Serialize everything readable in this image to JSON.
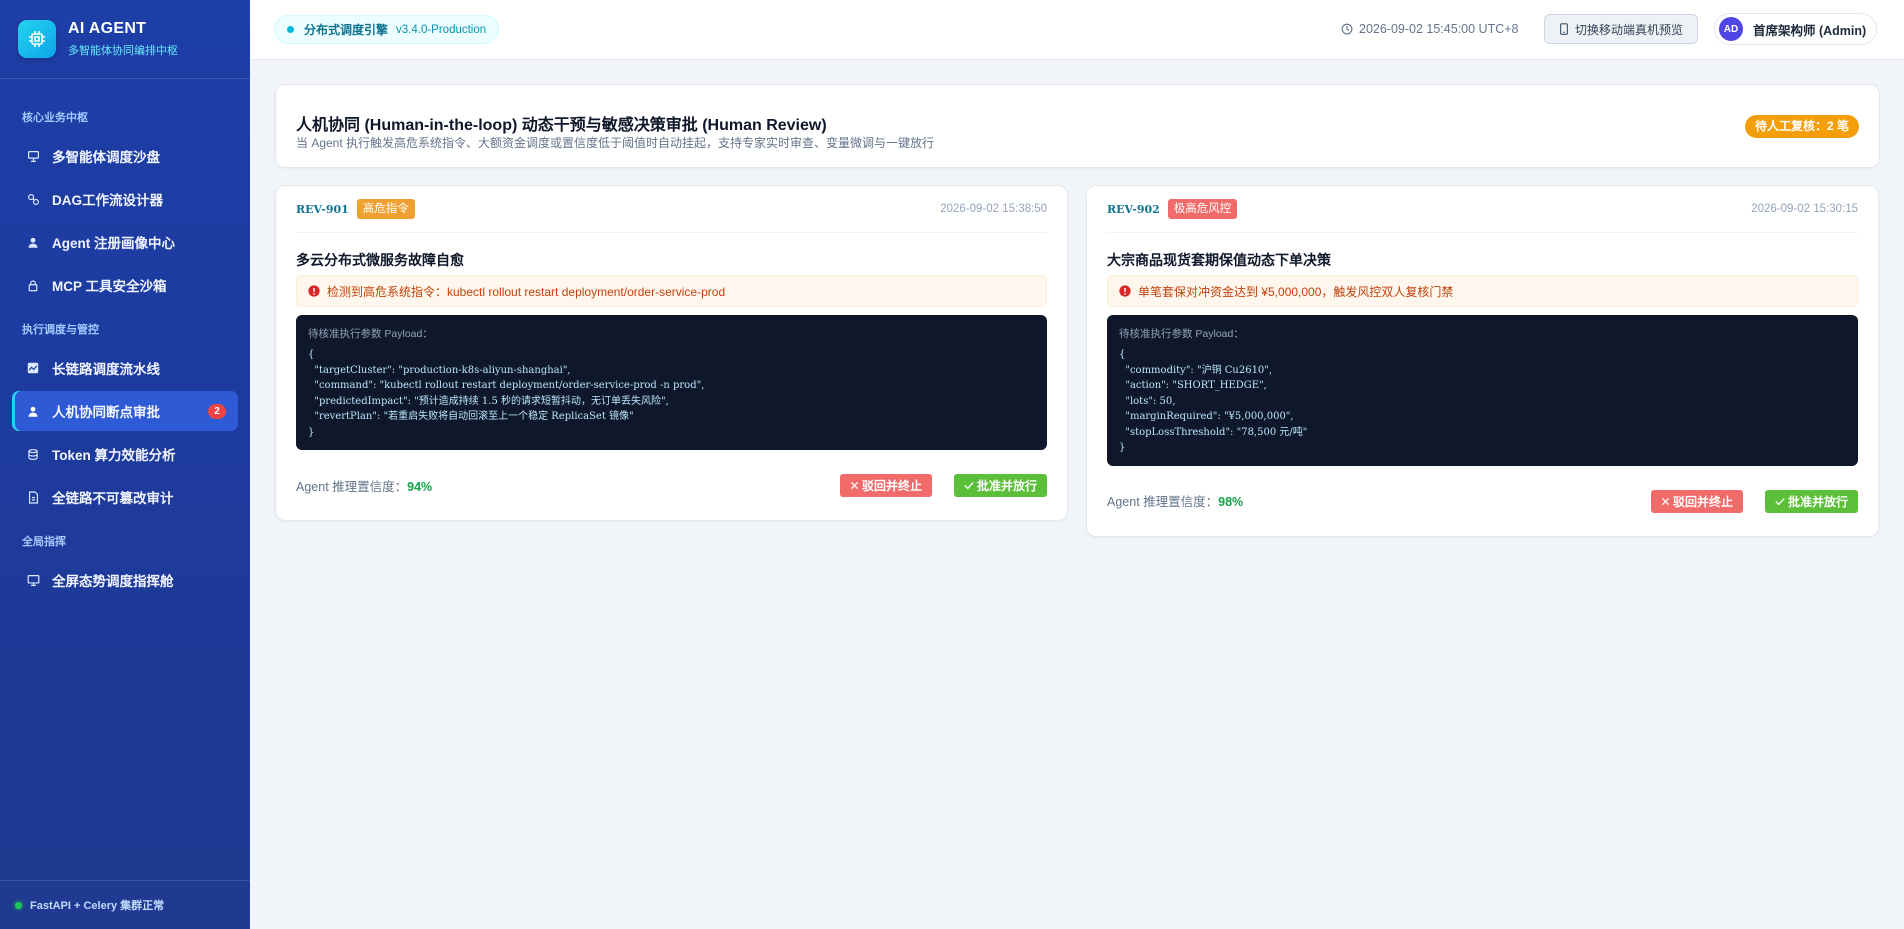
{
  "sidebar": {
    "brand": {
      "title": "AI AGENT",
      "subtitle": "多智能体协同编排中枢"
    },
    "sections": [
      {
        "label": "核心业务中枢",
        "items": [
          {
            "label": "多智能体调度沙盘",
            "icon": "presentation-icon"
          },
          {
            "label": "DAG工作流设计器",
            "icon": "workflow-icon"
          },
          {
            "label": "Agent 注册画像中心",
            "icon": "user-icon"
          },
          {
            "label": "MCP 工具安全沙箱",
            "icon": "lock-icon"
          }
        ]
      },
      {
        "label": "执行调度与管控",
        "items": [
          {
            "label": "长链路调度流水线",
            "icon": "chart-line-icon"
          },
          {
            "label": "人机协同断点审批",
            "icon": "user-check-icon",
            "badge": "2",
            "active": true
          },
          {
            "label": "Token 算力效能分析",
            "icon": "database-icon"
          },
          {
            "label": "全链路不可篡改审计",
            "icon": "file-icon"
          }
        ]
      },
      {
        "label": "全局指挥",
        "items": [
          {
            "label": "全屏态势调度指挥舱",
            "icon": "monitor-icon"
          }
        ]
      }
    ],
    "footer": {
      "status": "FastAPI + Celery 集群正常"
    }
  },
  "topbar": {
    "engine_label": "分布式调度引擎",
    "engine_version": "v3.4.0-Production",
    "clock": "2026-09-02 15:45:00 UTC+8",
    "mobile_preview": "切换移动端真机预览",
    "user": {
      "initials": "AD",
      "name": "首席架构师 (Admin)"
    }
  },
  "header": {
    "title": "人机协同 (Human-in-the-loop) 动态干预与敏感决策审批 (Human Review)",
    "description": "当 Agent 执行触发高危系统指令、大额资金调度或置信度低于阈值时自动挂起，支持专家实时审查、变量微调与一键放行",
    "pending": "待人工复核：2 笔"
  },
  "reviews": [
    {
      "id": "REV-901",
      "level": "高危指令",
      "time": "2026-09-02 15:38:50",
      "title": "多云分布式微服务故障自愈",
      "alert": "检测到高危系统指令：kubectl rollout restart deployment/order-service-prod",
      "payload_label": "待核准执行参数 Payload：",
      "code": [
        "{",
        "  \"targetCluster\": \"production-k8s-aliyun-shanghai\",",
        "  \"command\": \"kubectl rollout restart deployment/order-service-prod -n prod\",",
        "  \"predictedImpact\": \"预计造成持续 1.5 秒的请求短暂抖动，无订单丢失风险\",",
        "  \"revertPlan\": \"若重启失败将自动回滚至上一个稳定 ReplicaSet 镜像\"",
        "}"
      ],
      "confidence_label": "Agent 推理置信度：",
      "confidence": "94%",
      "reject": "驳回并终止",
      "approve": "批准并放行"
    },
    {
      "id": "REV-902",
      "level": "极高危风控",
      "time": "2026-09-02 15:30:15",
      "title": "大宗商品现货套期保值动态下单决策",
      "alert": "单笔套保对冲资金达到 ¥5,000,000，触发风控双人复核门禁",
      "payload_label": "待核准执行参数 Payload：",
      "code": [
        "{",
        "  \"commodity\": \"沪铜 Cu2610\",",
        "  \"action\": \"SHORT_HEDGE\",",
        "  \"lots\": 50,",
        "  \"marginRequired\": \"¥5,000,000\",",
        "  \"stopLossThreshold\": \"78,500 元/吨\"",
        "}"
      ],
      "confidence_label": "Agent 推理置信度：",
      "confidence": "98%",
      "reject": "驳回并终止",
      "approve": "批准并放行"
    }
  ]
}
